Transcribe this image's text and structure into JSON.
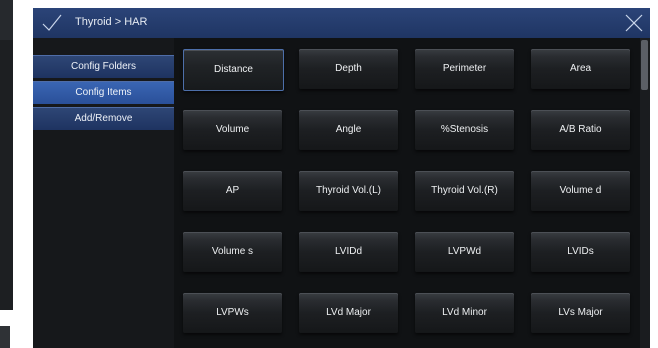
{
  "header": {
    "title": "Thyroid > HAR"
  },
  "sidebar": {
    "items": [
      {
        "label": "Config Folders"
      },
      {
        "label": "Config Items"
      },
      {
        "label": "Add/Remove"
      }
    ]
  },
  "grid": {
    "buttons": [
      "Distance",
      "Depth",
      "Perimeter",
      "Area",
      "Volume",
      "Angle",
      "%Stenosis",
      "A/B Ratio",
      "AP",
      "Thyroid Vol.(L)",
      "Thyroid Vol.(R)",
      "Volume d",
      "Volume s",
      "LVIDd",
      "LVPWd",
      "LVIDs",
      "LVPWs",
      "LVd Major",
      "LVd Minor",
      "LVs Major"
    ]
  },
  "colors": {
    "titlebar": "#2b4478",
    "sidebar_active": "#3a66b3",
    "selected_border": "#4d6faa"
  },
  "icons": [
    "check-icon",
    "close-icon"
  ]
}
